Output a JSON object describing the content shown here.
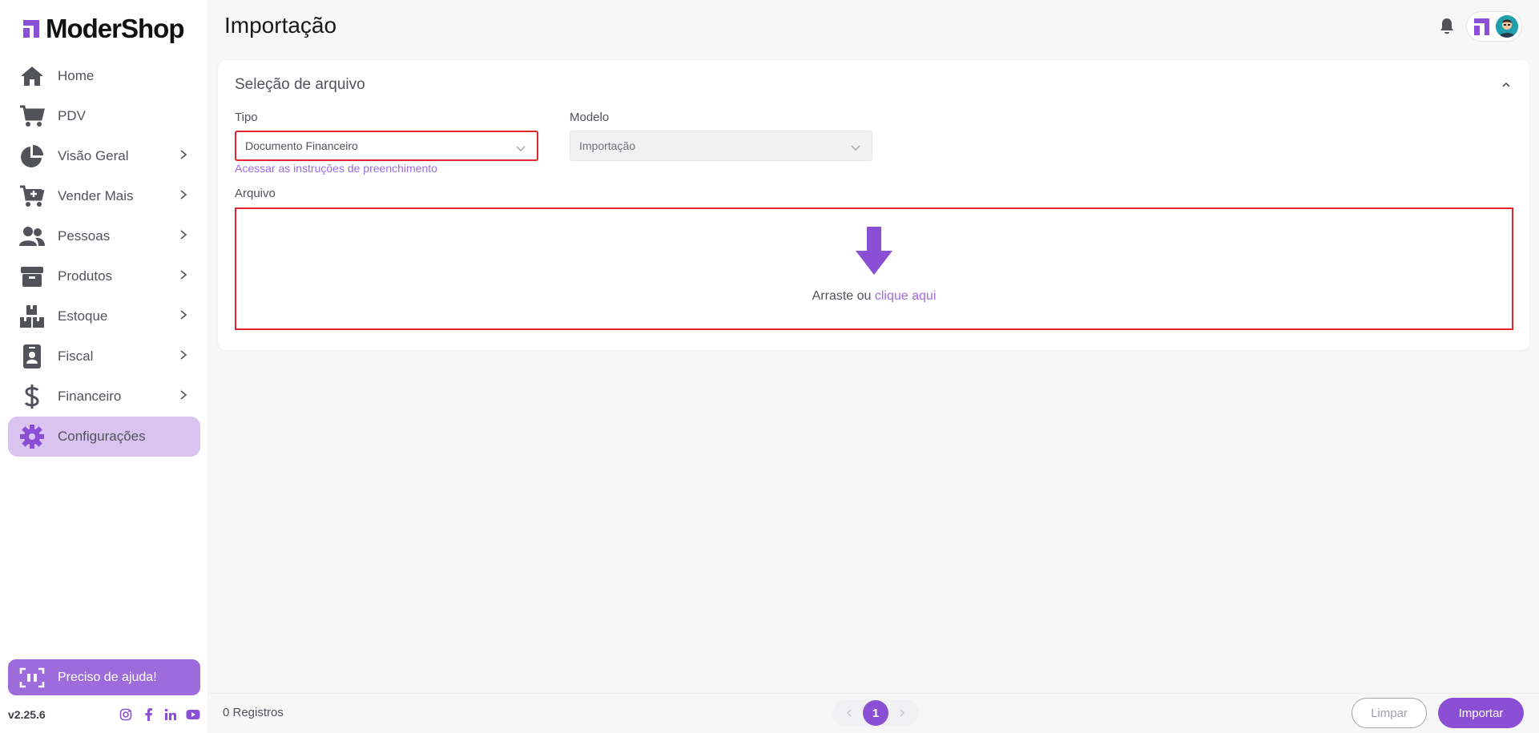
{
  "brand": {
    "name": "ModerShop",
    "accent": "#8a4fd4"
  },
  "sidebar": {
    "items": [
      {
        "label": "Home",
        "icon": "home-icon",
        "has_submenu": false
      },
      {
        "label": "PDV",
        "icon": "cart-icon",
        "has_submenu": false
      },
      {
        "label": "Visão Geral",
        "icon": "pie-chart-icon",
        "has_submenu": true
      },
      {
        "label": "Vender Mais",
        "icon": "cart-plus-icon",
        "has_submenu": true
      },
      {
        "label": "Pessoas",
        "icon": "users-icon",
        "has_submenu": true
      },
      {
        "label": "Produtos",
        "icon": "box-icon",
        "has_submenu": true
      },
      {
        "label": "Estoque",
        "icon": "boxes-icon",
        "has_submenu": true
      },
      {
        "label": "Fiscal",
        "icon": "id-badge-icon",
        "has_submenu": true
      },
      {
        "label": "Financeiro",
        "icon": "dollar-icon",
        "has_submenu": true
      },
      {
        "label": "Configurações",
        "icon": "gear-icon",
        "has_submenu": false,
        "active": true
      }
    ],
    "help_label": "Preciso de ajuda!",
    "version": "v2.25.6"
  },
  "header": {
    "title": "Importação"
  },
  "card": {
    "title": "Seleção de arquivo",
    "tipo_label": "Tipo",
    "tipo_value": "Documento Financeiro",
    "modelo_label": "Modelo",
    "modelo_value": "Importação",
    "instructions_link": "Acessar as instruções de preenchimento",
    "arquivo_label": "Arquivo",
    "dropzone_text": "Arraste ou",
    "dropzone_link": "clique aqui"
  },
  "footer": {
    "records": "0 Registros",
    "current_page": "1",
    "clear_label": "Limpar",
    "import_label": "Importar"
  }
}
